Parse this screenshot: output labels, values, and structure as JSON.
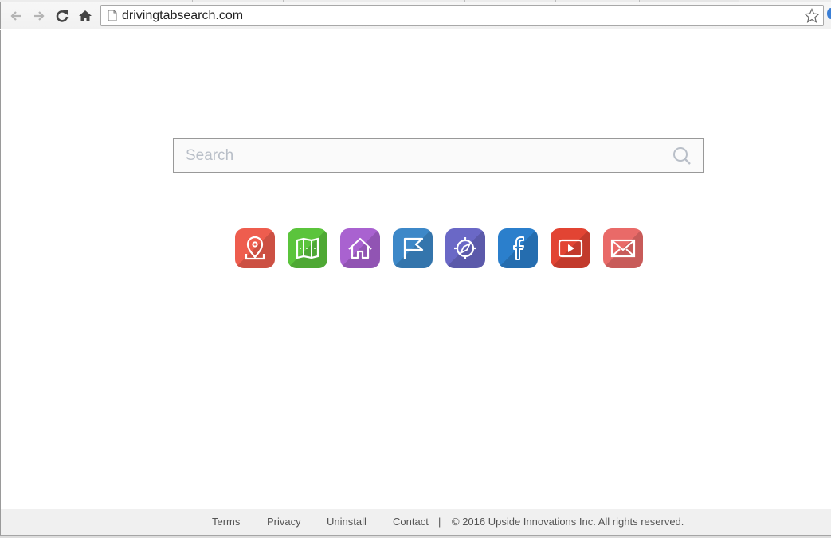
{
  "browser": {
    "url": "drivingtabsearch.com",
    "nav_buttons": [
      "back-icon",
      "forward-icon",
      "reload-icon",
      "home-icon"
    ],
    "bookmark_icon": "star-icon"
  },
  "search": {
    "placeholder": "Search",
    "value": "",
    "icon": "search-icon"
  },
  "tiles": [
    {
      "name": "maps-pin",
      "icon": "location-pin-icon",
      "color": "#ee5d4e"
    },
    {
      "name": "map",
      "icon": "folded-map-icon",
      "color": "#5bc43c"
    },
    {
      "name": "home",
      "icon": "house-icon",
      "color": "#a962d0"
    },
    {
      "name": "flag",
      "icon": "flag-icon",
      "color": "#3d88c8"
    },
    {
      "name": "compass",
      "icon": "compass-icon",
      "color": "#6a68c6"
    },
    {
      "name": "facebook",
      "icon": "facebook-icon",
      "color": "#2b7fcc"
    },
    {
      "name": "youtube",
      "icon": "youtube-icon",
      "color": "#e24433"
    },
    {
      "name": "mail",
      "icon": "envelope-icon",
      "color": "#e96a68"
    }
  ],
  "footer": {
    "links": [
      "Terms",
      "Privacy",
      "Uninstall",
      "Contact"
    ],
    "separator": "|",
    "copyright": "© 2016 Upside Innovations Inc. All rights reserved."
  }
}
